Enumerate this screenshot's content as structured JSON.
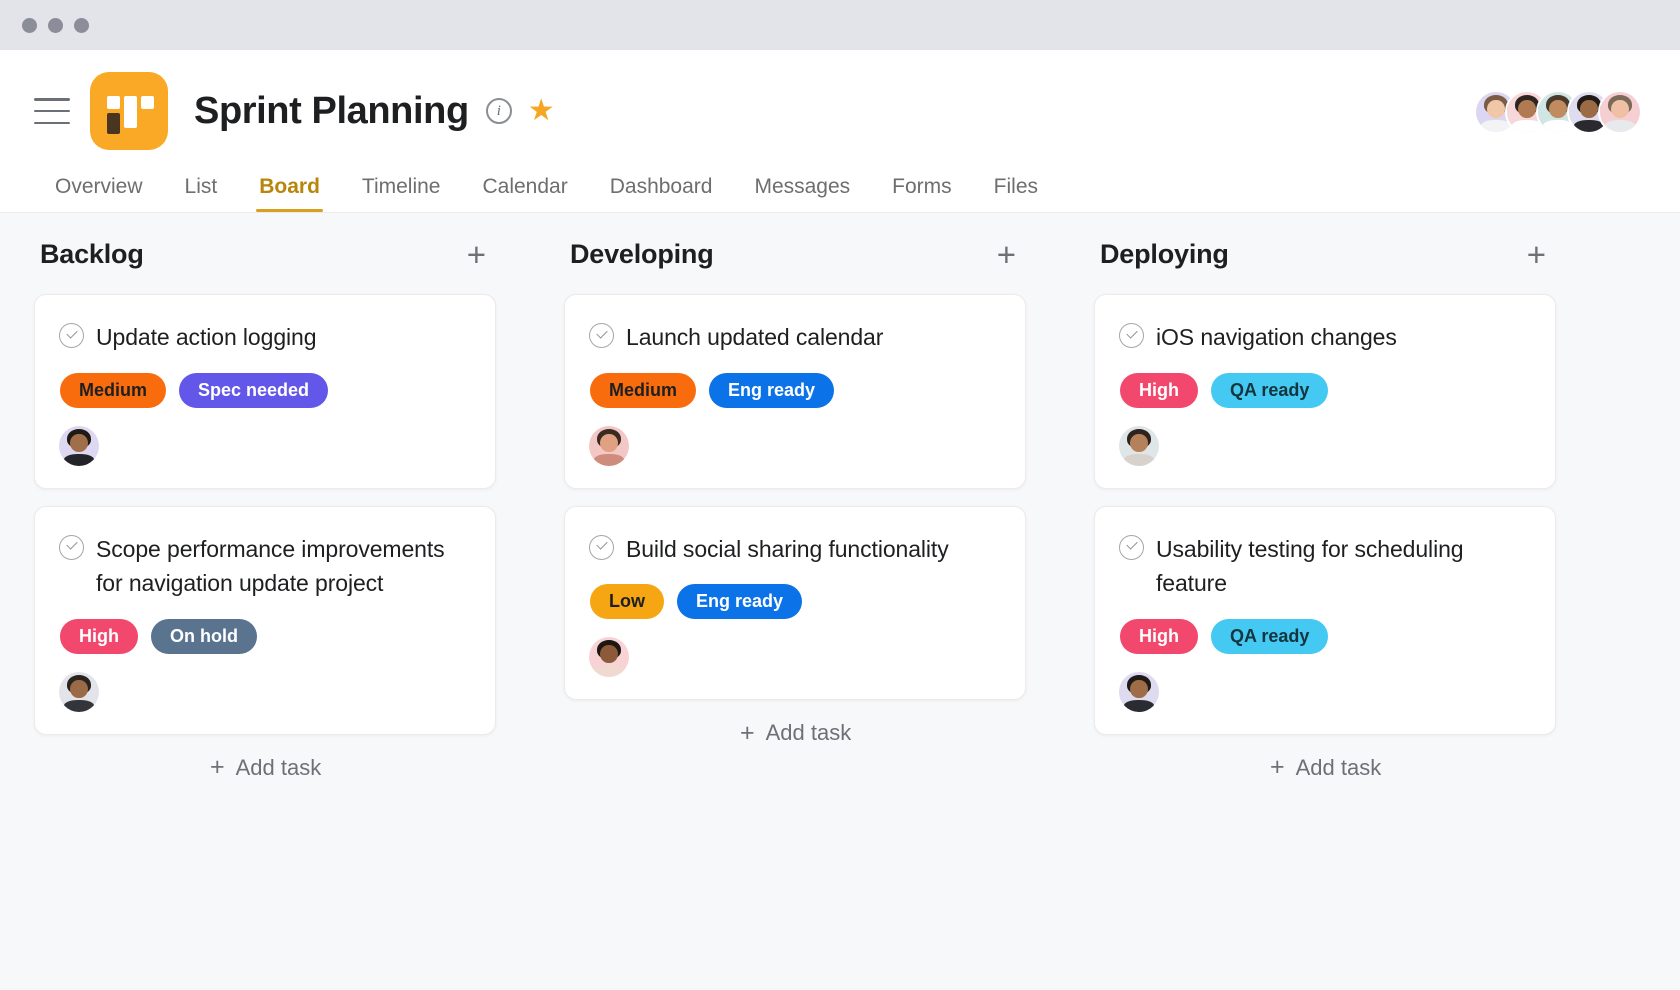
{
  "window": {
    "dots": [
      "close",
      "minimize",
      "maximize"
    ]
  },
  "header": {
    "menu_icon": "hamburger-icon",
    "project_icon": "board-app-icon",
    "title": "Sprint Planning",
    "info_icon": "i",
    "info_icon_name": "info-icon",
    "star_icon": "★",
    "star_icon_name": "star-icon",
    "accent_color": "#f9a925",
    "members": [
      {
        "name": "member-1",
        "bg": "#ddd6f3",
        "hair": "#7a5c44",
        "skin": "#f0c8a8",
        "body": "#f2f3f5"
      },
      {
        "name": "member-2",
        "bg": "#f7d7d9",
        "hair": "#2e2420",
        "skin": "#b07a52",
        "body": "#ffffff"
      },
      {
        "name": "member-3",
        "bg": "#cfe6e4",
        "hair": "#4a3a2c",
        "skin": "#c08b5e",
        "body": "#ffffff"
      },
      {
        "name": "member-4",
        "bg": "#e0dcf0",
        "hair": "#211a16",
        "skin": "#9c6b45",
        "body": "#2a2a2e"
      },
      {
        "name": "member-5",
        "bg": "#f6cfd2",
        "hair": "#7b6a58",
        "skin": "#f0c0a4",
        "body": "#e8e9ec"
      }
    ]
  },
  "tabs": [
    {
      "label": "Overview",
      "active": false
    },
    {
      "label": "List",
      "active": false
    },
    {
      "label": "Board",
      "active": true
    },
    {
      "label": "Timeline",
      "active": false
    },
    {
      "label": "Calendar",
      "active": false
    },
    {
      "label": "Dashboard",
      "active": false
    },
    {
      "label": "Messages",
      "active": false
    },
    {
      "label": "Forms",
      "active": false
    },
    {
      "label": "Files",
      "active": false
    }
  ],
  "board": {
    "add_task_label": "Add task",
    "add_column_icon": "+",
    "columns": [
      {
        "title": "Backlog",
        "cards": [
          {
            "title": "Update action logging",
            "tags": [
              {
                "label": "Medium",
                "bg": "#f96c0e",
                "fg": "#1e1f21"
              },
              {
                "label": "Spec needed",
                "bg": "#6257e8",
                "fg": "#ffffff"
              }
            ],
            "assignee": {
              "name": "assignee-avatar",
              "bg": "#ded7f2",
              "hair": "#201a16",
              "skin": "#a06f49",
              "body": "#23242a"
            }
          },
          {
            "title": "Scope performance improvements for navigation update project",
            "tags": [
              {
                "label": "High",
                "bg": "#f3486d",
                "fg": "#ffffff"
              },
              {
                "label": "On hold",
                "bg": "#5a7490",
                "fg": "#ffffff"
              }
            ],
            "assignee": {
              "name": "assignee-avatar",
              "bg": "#e3e4ea",
              "hair": "#2a2420",
              "skin": "#9a6b46",
              "body": "#34353b"
            }
          }
        ]
      },
      {
        "title": "Developing",
        "cards": [
          {
            "title": "Launch updated calendar",
            "tags": [
              {
                "label": "Medium",
                "bg": "#f96c0e",
                "fg": "#1e1f21"
              },
              {
                "label": "Eng ready",
                "bg": "#0c72e8",
                "fg": "#ffffff"
              }
            ],
            "assignee": {
              "name": "assignee-avatar",
              "bg": "#f3c7c6",
              "hair": "#3a2a20",
              "skin": "#e0a183",
              "body": "#cf8b7c"
            }
          },
          {
            "title": "Build social sharing functionality",
            "tags": [
              {
                "label": "Low",
                "bg": "#f6a613",
                "fg": "#1e1f21"
              },
              {
                "label": "Eng ready",
                "bg": "#0c72e8",
                "fg": "#ffffff"
              }
            ],
            "assignee": {
              "name": "assignee-avatar",
              "bg": "#f7d3d6",
              "hair": "#1d1613",
              "skin": "#8c5a38",
              "body": "#f0d9cf"
            }
          }
        ]
      },
      {
        "title": "Deploying",
        "cards": [
          {
            "title": "iOS navigation changes",
            "tags": [
              {
                "label": "High",
                "bg": "#f3486d",
                "fg": "#ffffff"
              },
              {
                "label": "QA ready",
                "bg": "#43c9f2",
                "fg": "#14353f"
              }
            ],
            "assignee": {
              "name": "assignee-avatar",
              "bg": "#dfe6e8",
              "hair": "#2d2420",
              "skin": "#b5815a",
              "body": "#d8d2cc"
            }
          },
          {
            "title": "Usability testing for scheduling feature",
            "tags": [
              {
                "label": "High",
                "bg": "#f3486d",
                "fg": "#ffffff"
              },
              {
                "label": "QA ready",
                "bg": "#43c9f2",
                "fg": "#14353f"
              }
            ],
            "assignee": {
              "name": "assignee-avatar",
              "bg": "#dedaf0",
              "hair": "#1e1a17",
              "skin": "#9e6c46",
              "body": "#2b2c31"
            }
          }
        ]
      }
    ]
  }
}
